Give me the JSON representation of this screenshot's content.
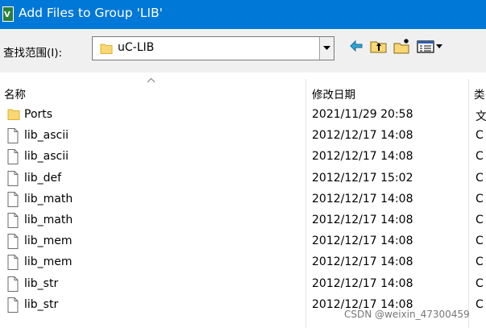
{
  "window": {
    "title": "Add Files to Group 'LIB'"
  },
  "toolbar": {
    "lookin_label": "查找范围(I):",
    "lookin_value": "uC-LIB",
    "icons": [
      "back-arrow-icon",
      "up-folder-icon",
      "new-folder-icon",
      "view-menu-icon"
    ]
  },
  "columns": {
    "name": "名称",
    "date": "修改日期",
    "type": "类"
  },
  "files": [
    {
      "name": "Ports",
      "date": "2021/11/29 20:58",
      "type": "文",
      "kind": "folder"
    },
    {
      "name": "lib_ascii",
      "date": "2012/12/17 14:08",
      "type": "C",
      "kind": "file"
    },
    {
      "name": "lib_ascii",
      "date": "2012/12/17 14:08",
      "type": "C",
      "kind": "file"
    },
    {
      "name": "lib_def",
      "date": "2012/12/17 15:02",
      "type": "C",
      "kind": "file"
    },
    {
      "name": "lib_math",
      "date": "2012/12/17 14:08",
      "type": "C",
      "kind": "file"
    },
    {
      "name": "lib_math",
      "date": "2012/12/17 14:08",
      "type": "C",
      "kind": "file"
    },
    {
      "name": "lib_mem",
      "date": "2012/12/17 14:08",
      "type": "C",
      "kind": "file"
    },
    {
      "name": "lib_mem",
      "date": "2012/12/17 14:08",
      "type": "C",
      "kind": "file"
    },
    {
      "name": "lib_str",
      "date": "2012/12/17 14:08",
      "type": "C",
      "kind": "file"
    },
    {
      "name": "lib_str",
      "date": "2012/12/17 14:08",
      "type": "C",
      "kind": "file"
    }
  ],
  "watermark": "CSDN @weixin_47300459",
  "colors": {
    "titlebar": "#0078d7",
    "folder": "#f5c542",
    "toolbar_bg": "#f0f0f0"
  }
}
